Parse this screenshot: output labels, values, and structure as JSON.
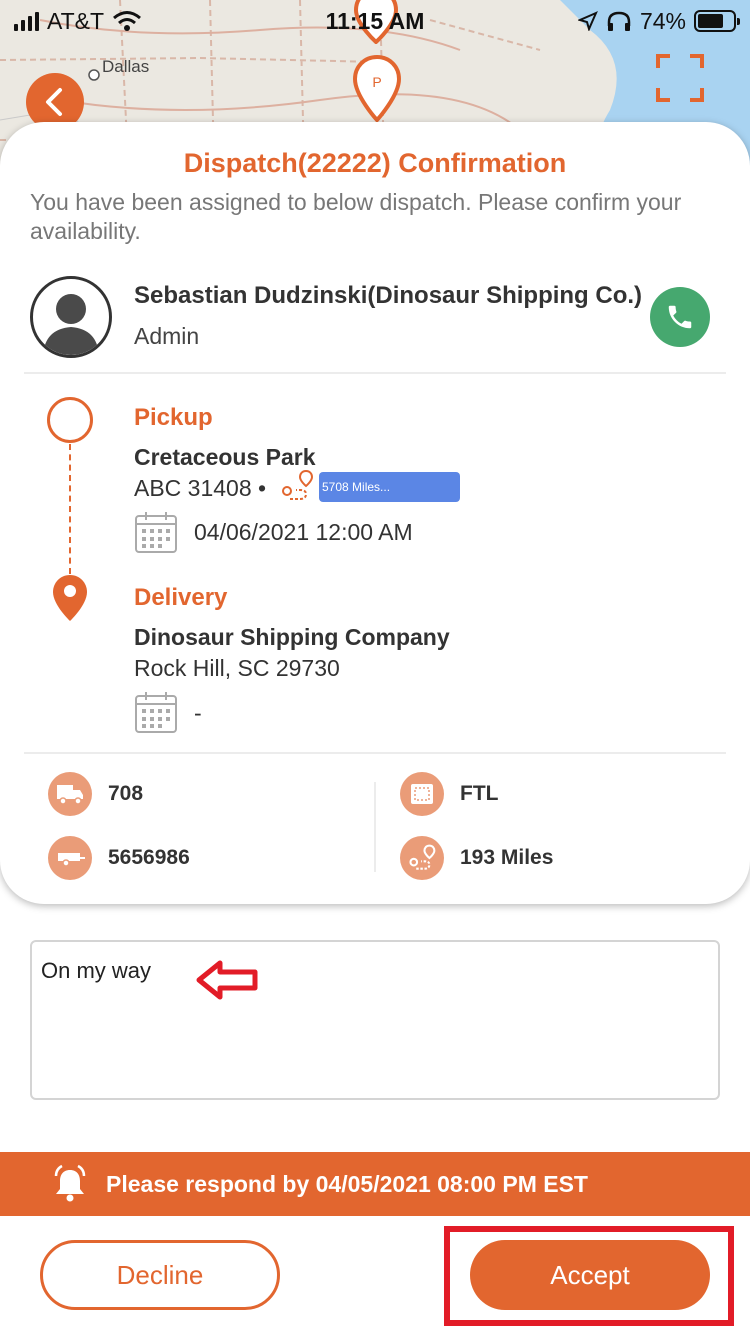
{
  "status_bar": {
    "carrier": "AT&T",
    "time": "11:15 AM",
    "battery": "74%"
  },
  "map": {
    "city_label": "Dallas",
    "pin_label": "P"
  },
  "card": {
    "title": "Dispatch(22222) Confirmation",
    "subtitle": "You have been assigned to below dispatch. Please confirm your availability.",
    "contact": {
      "name": "Sebastian Dudzinski(Dinosaur Shipping Co.)",
      "role": "Admin"
    },
    "pickup": {
      "label": "Pickup",
      "name": "Cretaceous Park",
      "address": "ABC 31408 •",
      "miles": "5708 Miles...",
      "date": "04/06/2021 12:00 AM"
    },
    "delivery": {
      "label": "Delivery",
      "name": "Dinosaur Shipping Company",
      "address": "Rock Hill, SC 29730",
      "date": "-"
    },
    "info": {
      "truck": "708",
      "trailer": "5656986",
      "load_type": "FTL",
      "distance": "193 Miles"
    }
  },
  "note": {
    "value": "On my way"
  },
  "respond_bar": {
    "text": "Please respond by 04/05/2021 08:00 PM EST"
  },
  "actions": {
    "decline": "Decline",
    "accept": "Accept"
  },
  "colors": {
    "accent": "#e2662f",
    "call": "#46a86f",
    "miles_badge": "#5b86e5",
    "highlight": "#e21c27"
  }
}
